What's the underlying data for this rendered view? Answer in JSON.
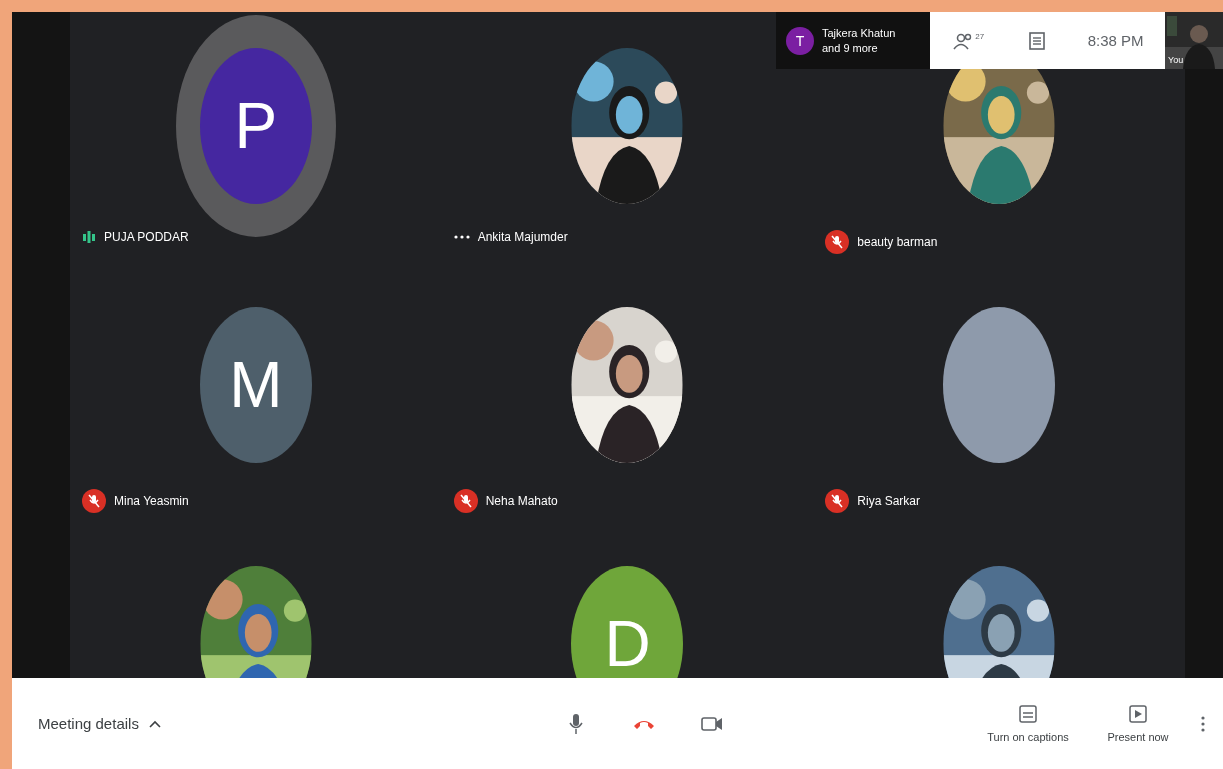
{
  "notification": {
    "initial": "T",
    "color": "#7b1fa2",
    "line_1": "Tajkera Khatun",
    "line_2": "and 9 more"
  },
  "info_panel": {
    "participant_count": "27",
    "time": "8:38 PM"
  },
  "self_view": {
    "label": "You",
    "kind": "picture"
  },
  "participants": [
    {
      "name": "PUJA PODDAR",
      "speaking": true,
      "muted": false,
      "avatar": {
        "kind": "letter",
        "letter": "P",
        "color": "#4527a0"
      }
    },
    {
      "name": "Ankita Majumder",
      "speaking": false,
      "muted": false,
      "avatar": {
        "kind": "picture"
      }
    },
    {
      "name": "beauty barman",
      "speaking": false,
      "muted": true,
      "avatar": {
        "kind": "picture"
      }
    },
    {
      "name": "Mina Yeasmin",
      "speaking": false,
      "muted": true,
      "avatar": {
        "kind": "letter",
        "letter": "M",
        "color": "#4e5f6b"
      }
    },
    {
      "name": "Neha Mahato",
      "speaking": false,
      "muted": true,
      "avatar": {
        "kind": "picture"
      }
    },
    {
      "name": "Riya Sarkar",
      "speaking": false,
      "muted": true,
      "avatar": {
        "kind": "blank",
        "color": "#8e9aab"
      }
    },
    {
      "avatar": {
        "kind": "picture"
      }
    },
    {
      "avatar": {
        "kind": "letter",
        "letter": "D",
        "color": "#6fa63a"
      }
    },
    {
      "avatar": {
        "kind": "picture"
      }
    }
  ],
  "bottom_bar": {
    "meeting_details": "Meeting details",
    "actions": [
      {
        "kind": "captions",
        "label": "Turn on captions"
      },
      {
        "kind": "present",
        "label": "Present now"
      }
    ]
  }
}
